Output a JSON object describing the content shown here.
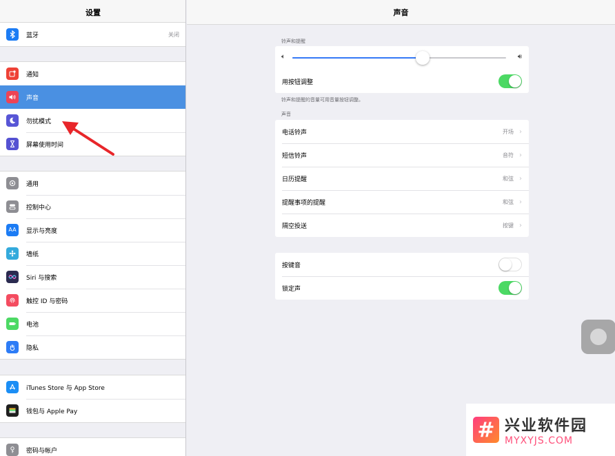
{
  "left": {
    "title": "设置",
    "groups": [
      {
        "items": [
          {
            "label": "蓝牙",
            "value": "关闭",
            "icon": "bluetooth-icon",
            "color": "#1c7cf4"
          }
        ]
      },
      {
        "items": [
          {
            "label": "通知",
            "icon": "notifications-icon",
            "color": "#ee4136"
          },
          {
            "label": "声音",
            "icon": "sounds-icon",
            "color": "#ee4355",
            "selected": true
          },
          {
            "label": "勿扰模式",
            "icon": "moon-icon",
            "color": "#5856d6"
          },
          {
            "label": "屏幕使用时间",
            "icon": "hourglass-icon",
            "color": "#5552d2"
          }
        ]
      },
      {
        "items": [
          {
            "label": "通用",
            "icon": "gear-icon",
            "color": "#8e8e93"
          },
          {
            "label": "控制中心",
            "icon": "control-center-icon",
            "color": "#8e8e93"
          },
          {
            "label": "显示与亮度",
            "icon": "display-icon",
            "color": "#1c7cf4"
          },
          {
            "label": "墙纸",
            "icon": "wallpaper-icon",
            "color": "#34aadc"
          },
          {
            "label": "Siri 与搜索",
            "icon": "siri-icon",
            "color": "#2b2b50"
          },
          {
            "label": "触控 ID 与密码",
            "icon": "fingerprint-icon",
            "color": "#f44c60"
          },
          {
            "label": "电池",
            "icon": "battery-icon",
            "color": "#4cd964"
          },
          {
            "label": "隐私",
            "icon": "hand-icon",
            "color": "#2d7cf6"
          }
        ]
      },
      {
        "items": [
          {
            "label": "iTunes Store 与 App Store",
            "icon": "app-store-icon",
            "color": "#1b8ef5"
          },
          {
            "label": "钱包与 Apple Pay",
            "icon": "wallet-icon",
            "color": "#1f1f1f"
          }
        ]
      },
      {
        "items": [
          {
            "label": "密码与帐户",
            "icon": "key-icon",
            "color": "#8e8e93"
          }
        ]
      }
    ]
  },
  "right": {
    "title": "声音",
    "ringer_section": "铃声和提醒",
    "volume_level": 0.61,
    "change_with_buttons": {
      "label": "用按钮调整",
      "on": true
    },
    "ringer_note": "铃声和提醒的音量可用音量按钮调整。",
    "sounds_section": "声音",
    "sounds": [
      {
        "label": "电话铃声",
        "value": "开场"
      },
      {
        "label": "短信铃声",
        "value": "音符"
      },
      {
        "label": "日历提醒",
        "value": "和弦"
      },
      {
        "label": "提醒事项的提醒",
        "value": "和弦"
      },
      {
        "label": "隔空投送",
        "value": "按键"
      }
    ],
    "toggles": [
      {
        "label": "按键音",
        "on": false
      },
      {
        "label": "锁定声",
        "on": true
      }
    ]
  },
  "watermark": {
    "cn": "兴业软件园",
    "en": "MYXYJS.COM",
    "logo_char": "#"
  }
}
